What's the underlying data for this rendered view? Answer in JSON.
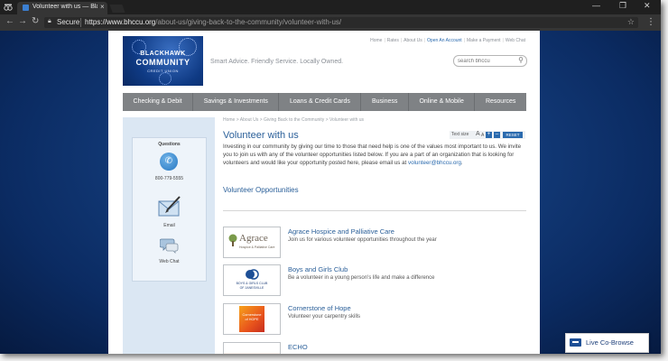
{
  "browser": {
    "tab_title": "Volunteer with us — Bla",
    "tab_close": "×",
    "nav": {
      "back": "←",
      "forward": "→",
      "reload": "↻"
    },
    "window_controls": {
      "minimize": "—",
      "maximize": "❐",
      "close": "✕"
    },
    "address": {
      "secure_label": "Secure",
      "url_host": "https://www.bhccu.org",
      "url_path": "/about-us/giving-back-to-the-community/volunteer-with-us/"
    },
    "menu": "⋮"
  },
  "header": {
    "logo": {
      "line1": "BLACKHAWK",
      "line2": "COMMUNITY",
      "line3": "CREDIT UNION"
    },
    "tagline": "Smart Advice. Friendly Service. Locally Owned.",
    "top_links": [
      "Home",
      "Rates",
      "About Us",
      "Open An Account",
      "Make a Payment",
      "Web Chat"
    ],
    "search_placeholder": "search bhccu"
  },
  "main_nav": [
    "Checking & Debit",
    "Savings & Investments",
    "Loans & Credit Cards",
    "Business",
    "Online & Mobile",
    "Resources"
  ],
  "sidebar": {
    "questions_label": "Questions",
    "phone": "800-779-5555",
    "email_label": "Email",
    "webchat_label": "Web Chat"
  },
  "content": {
    "breadcrumb": "Home > About Us > Giving Back to the Community > Volunteer with us",
    "title": "Volunteer with us",
    "text_size": {
      "label": "Text size",
      "a_large": "A",
      "a_small": "A",
      "plus": "+",
      "minus": "–",
      "reset": "RESET"
    },
    "intro_1": "Investing in our community by giving our time to those that need help is one of the values most important to us. We invite you to join us with any of the volunteer opportunities listed below. If you are a part of an organization that is looking for volunteers and would like your opportunity posted here, please email us at ",
    "intro_email": "volunteer@bhccu.org",
    "intro_end": ".",
    "opportunities_title": "Volunteer Opportunities",
    "orgs": [
      {
        "name": "Agrace Hospice and Palliative Care",
        "desc": "Join us for various volunteer opportunities throughout the year",
        "logo_text": "Agrace",
        "logo_sub": "Hospice & Palliative Care"
      },
      {
        "name": "Boys and Girls Club",
        "desc": "Be a volunteer in a young person's life and make a difference",
        "logo_text": "BOYS & GIRLS CLUB",
        "logo_sub": "OF JANESVILLE"
      },
      {
        "name": "Cornerstone of Hope",
        "desc": "Volunteer your carpentry skills",
        "logo_text": "Cornerstone",
        "logo_sub": "of HOPE"
      },
      {
        "name": "ECHO",
        "desc": "",
        "logo_text": "",
        "logo_sub": ""
      }
    ]
  },
  "cobrowse": {
    "label": "Live Co-Browse"
  }
}
